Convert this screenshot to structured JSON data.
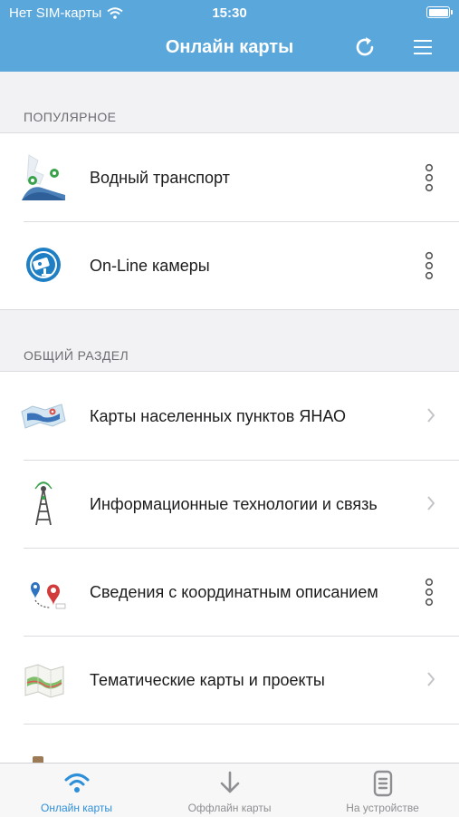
{
  "status": {
    "carrier": "Нет SIM-карты",
    "time": "15:30"
  },
  "header": {
    "title": "Онлайн карты",
    "refresh_icon": "refresh-icon",
    "menu_icon": "hamburger-menu-icon"
  },
  "sections": [
    {
      "title": "ПОПУЛЯРНОЕ",
      "items": [
        {
          "label": "Водный транспорт",
          "icon": "water-transport-icon",
          "accessory": "more"
        },
        {
          "label": "On-Line камеры",
          "icon": "camera-icon",
          "accessory": "more"
        }
      ]
    },
    {
      "title": "ОБЩИЙ РАЗДЕЛ",
      "items": [
        {
          "label": "Карты населенных пунктов ЯНАО",
          "icon": "settlement-map-icon",
          "accessory": "chevron"
        },
        {
          "label": "Информационные технологии и связь",
          "icon": "antenna-tower-icon",
          "accessory": "chevron"
        },
        {
          "label": "Сведения с координатным описанием",
          "icon": "coordinate-pins-icon",
          "accessory": "more"
        },
        {
          "label": "Тематические карты и проекты",
          "icon": "thematic-map-icon",
          "accessory": "chevron"
        }
      ]
    }
  ],
  "tabs": [
    {
      "label": "Онлайн карты",
      "icon": "wifi-icon",
      "active": true
    },
    {
      "label": "Оффлайн карты",
      "icon": "download-arrow-icon",
      "active": false
    },
    {
      "label": "На устройстве",
      "icon": "document-icon",
      "active": false
    }
  ],
  "colors": {
    "header": "#5aa7dc",
    "accent": "#2e8fd9",
    "background": "#f2f2f5"
  }
}
